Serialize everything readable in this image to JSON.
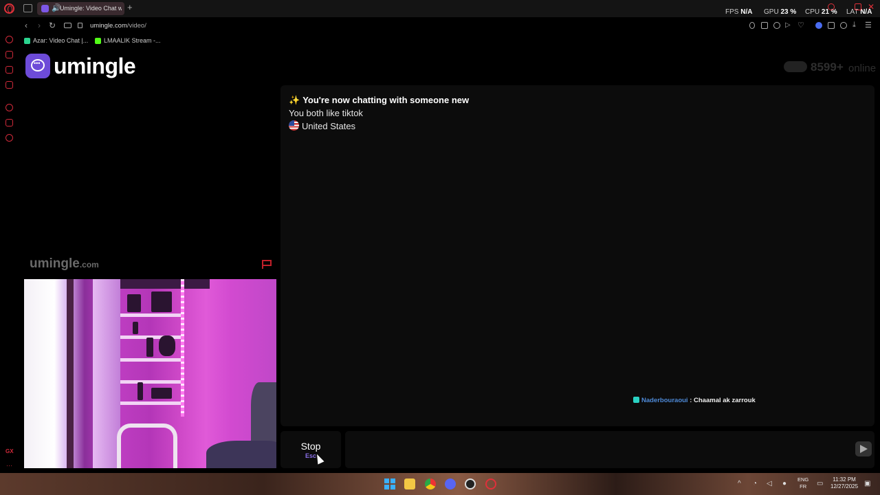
{
  "browser": {
    "tab_title": "Umingle: Video Chat w",
    "new_tab": "+",
    "hud": [
      {
        "label": "FPS",
        "value": "N/A"
      },
      {
        "label": "GPU",
        "value": "23 %"
      },
      {
        "label": "CPU",
        "value": "21 %"
      },
      {
        "label": "LAT",
        "value": "N/A"
      }
    ],
    "url_host": "umingle.com",
    "url_path": "/video/",
    "bookmarks": [
      {
        "label": "Azar: Video Chat |...",
        "color": "#2bd48f"
      },
      {
        "label": "LMAALIK Stream -...",
        "color": "#53fc18"
      }
    ]
  },
  "site": {
    "logo_text": "umingle",
    "online_count": "8599+",
    "online_label": "online",
    "watermark": "umingle",
    "watermark_suffix": ".com"
  },
  "chat": {
    "intro": "You're now chatting with someone new",
    "sparkle": "✨",
    "shared_interest": "You both like tiktok",
    "country": "United States",
    "message": {
      "user": "Naderbouraoui",
      "separator": " : ",
      "text": "Chaamal ak zarrouk"
    },
    "input_placeholder": ""
  },
  "controls": {
    "stop_label": "Stop",
    "stop_hint": "Esc"
  },
  "taskbar": {
    "lang_top": "ENG",
    "lang_bottom": "FR",
    "time": "11:32 PM",
    "date": "12/27/2025"
  },
  "colors": {
    "brand": "#6d4bd8",
    "opera_red": "#e0303a",
    "username": "#4e8ad8"
  }
}
